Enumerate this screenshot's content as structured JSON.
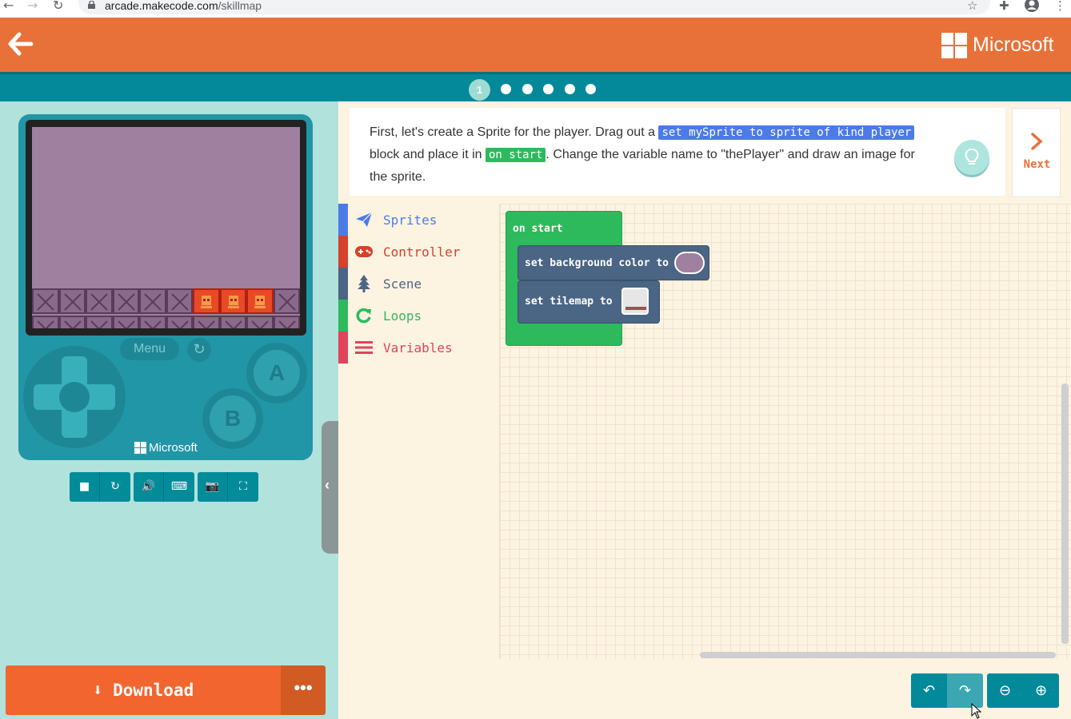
{
  "browser": {
    "url_host": "arcade.makecode.com",
    "url_path": "/skillmap"
  },
  "header": {
    "brand": "Microsoft"
  },
  "progress": {
    "current_step": "1",
    "total_steps": 6
  },
  "simulator": {
    "menu_label": "Menu",
    "button_a": "A",
    "button_b": "B",
    "console_brand": "Microsoft",
    "screen_color": "#a0809f"
  },
  "download": {
    "label": "Download",
    "more_label": "•••"
  },
  "instructions": {
    "part1": "First, let's create a Sprite for the player. Drag out a ",
    "chip1": "set mySprite to sprite of kind player",
    "part2": " block and place it in ",
    "chip2": "on start",
    "part3": ". Change the variable name to \"thePlayer\" and draw an image for the sprite.",
    "next_label": "Next"
  },
  "toolbox": [
    {
      "label": "Sprites",
      "color": "#4c7be8",
      "icon": "paper-plane-icon"
    },
    {
      "label": "Controller",
      "color": "#d5412b",
      "icon": "gamepad-icon"
    },
    {
      "label": "Scene",
      "color": "#4b6584",
      "icon": "tree-icon"
    },
    {
      "label": "Loops",
      "color": "#2dba5c",
      "icon": "loop-icon"
    },
    {
      "label": "Variables",
      "color": "#e2435a",
      "icon": "list-icon"
    }
  ],
  "blocks": {
    "on_start": "on start",
    "set_bg": "set background color to",
    "set_tilemap": "set tilemap to"
  }
}
